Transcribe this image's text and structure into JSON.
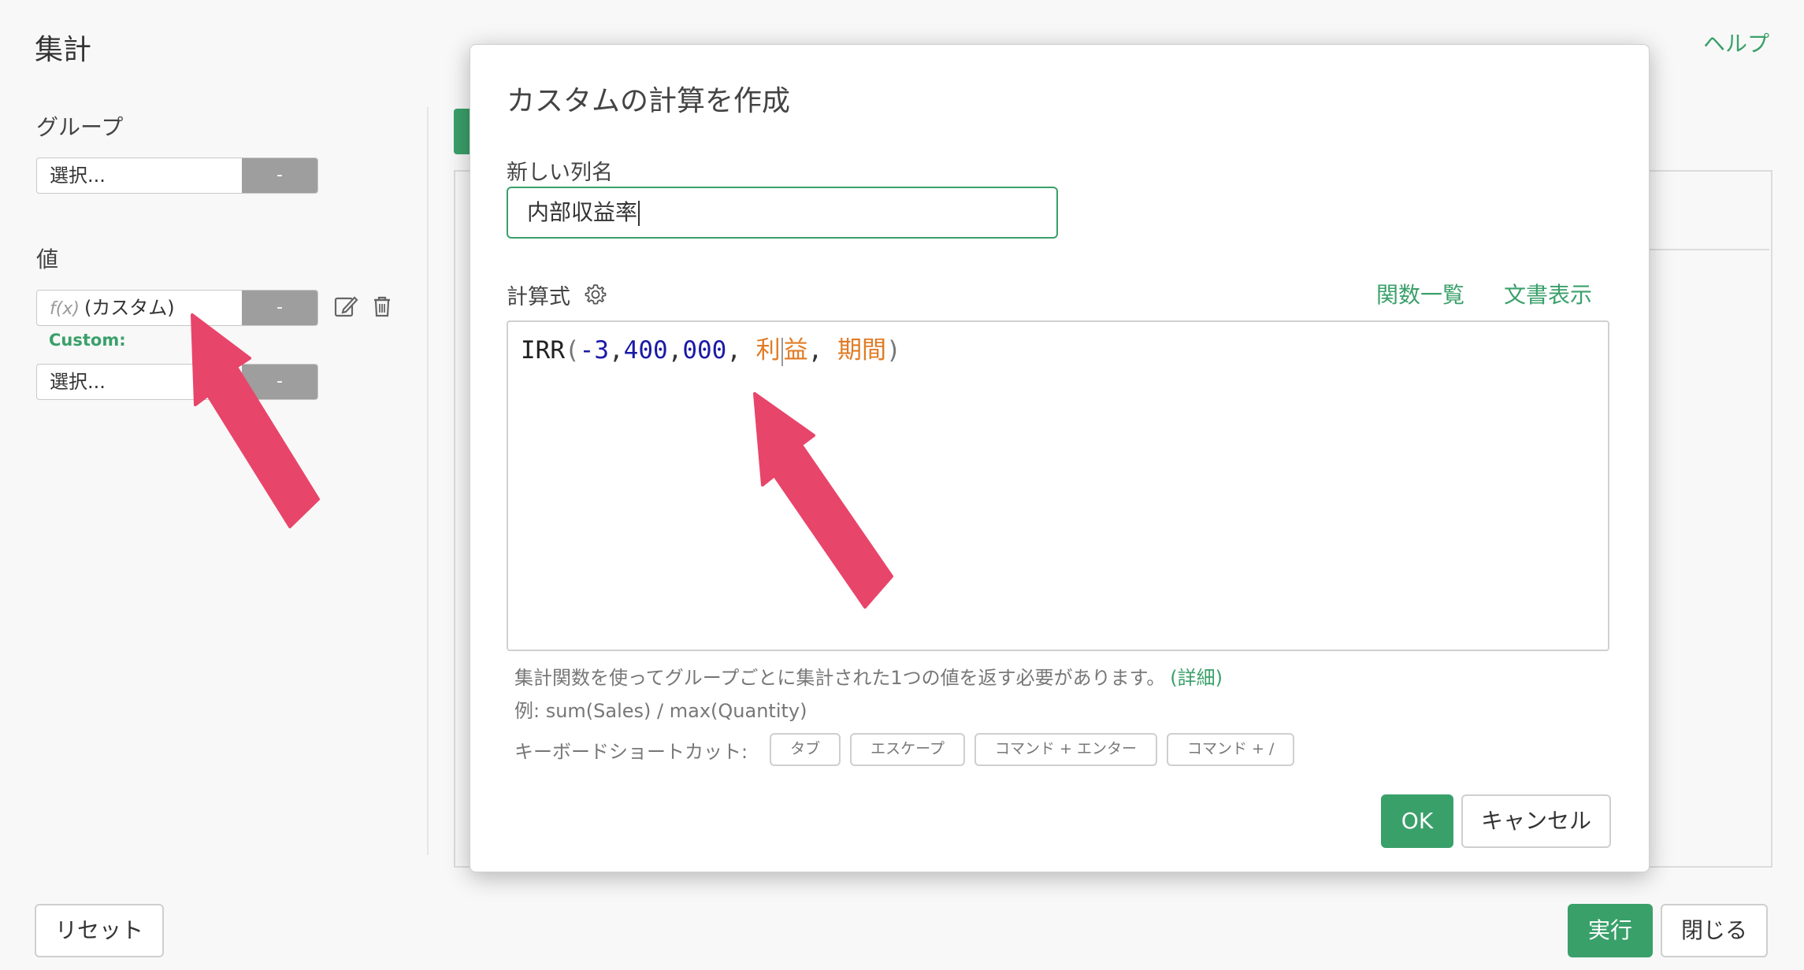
{
  "panel": {
    "title": "集計",
    "help": "ヘルプ",
    "group_label": "グループ",
    "group_select": "選択...",
    "group_btn": "-",
    "value_label": "値",
    "value_item_fx": "f(x)",
    "value_item": "(カスタム)",
    "value_btn": "-",
    "custom_label": "Custom:",
    "value_select": "選択...",
    "value_select_btn": "-"
  },
  "footer": {
    "reset": "リセット",
    "run": "実行",
    "close": "閉じる"
  },
  "modal": {
    "title": "カスタムの計算を作成",
    "new_col_label": "新しい列名",
    "new_col_value": "内部収益率",
    "formula_label": "計算式",
    "func_list": "関数一覧",
    "docs": "文書表示",
    "formula": {
      "fn": "IRR",
      "open": "(",
      "num1": "-3",
      "c1": ",",
      "num2": "400",
      "c2": ",",
      "num3": "000",
      "c3": ", ",
      "col1a": "利",
      "col1b": "益",
      "c4": ", ",
      "col2": "期間",
      "close": ")"
    },
    "hint1": "集計関数を使ってグループごとに集計された1つの値を返す必要があります。",
    "hint_detail": "(詳細)",
    "hint2": "例: sum(Sales) / max(Quantity)",
    "shortcut_label": "キーボードショートカット:",
    "shortcuts": [
      "タブ",
      "エスケープ",
      "コマンド + エンター",
      "コマンド + /"
    ],
    "ok": "OK",
    "cancel": "キャンセル"
  },
  "colors": {
    "accent": "#3aa06a",
    "arrow": "#e8456a"
  }
}
